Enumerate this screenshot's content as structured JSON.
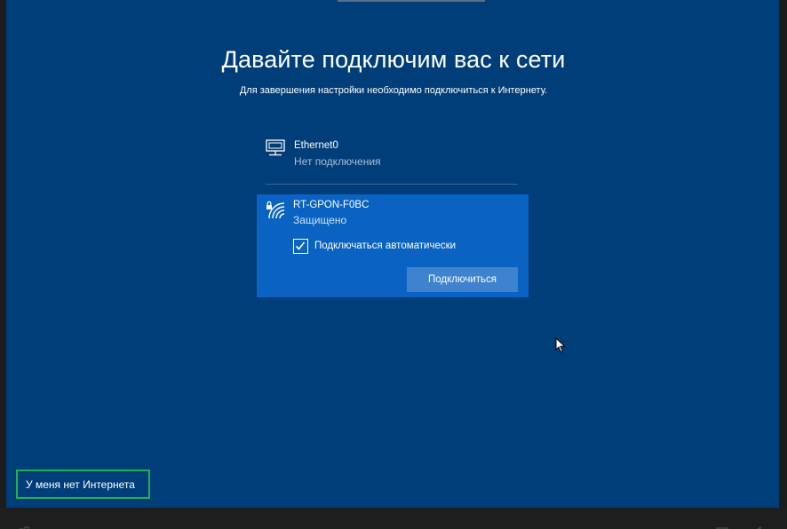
{
  "page": {
    "title": "Давайте подключим вас к сети",
    "subtitle": "Для завершения настройки необходимо подключиться к Интернету."
  },
  "networks": [
    {
      "name": "Ethernet0",
      "status": "Нет подключения",
      "icon": "ethernet-icon"
    },
    {
      "name": "RT-GPON-F0BC",
      "status": "Защищено",
      "icon": "wifi-secured-icon",
      "auto_connect_label": "Подключаться автоматически",
      "auto_connect_checked": true,
      "connect_label": "Подключиться"
    }
  ],
  "footer": {
    "no_internet_label": "У меня нет Интернета"
  },
  "colors": {
    "background": "#003e7a",
    "selected_network": "#0a63c2",
    "button": "#3f82cf",
    "highlight_box": "#22b24c"
  }
}
